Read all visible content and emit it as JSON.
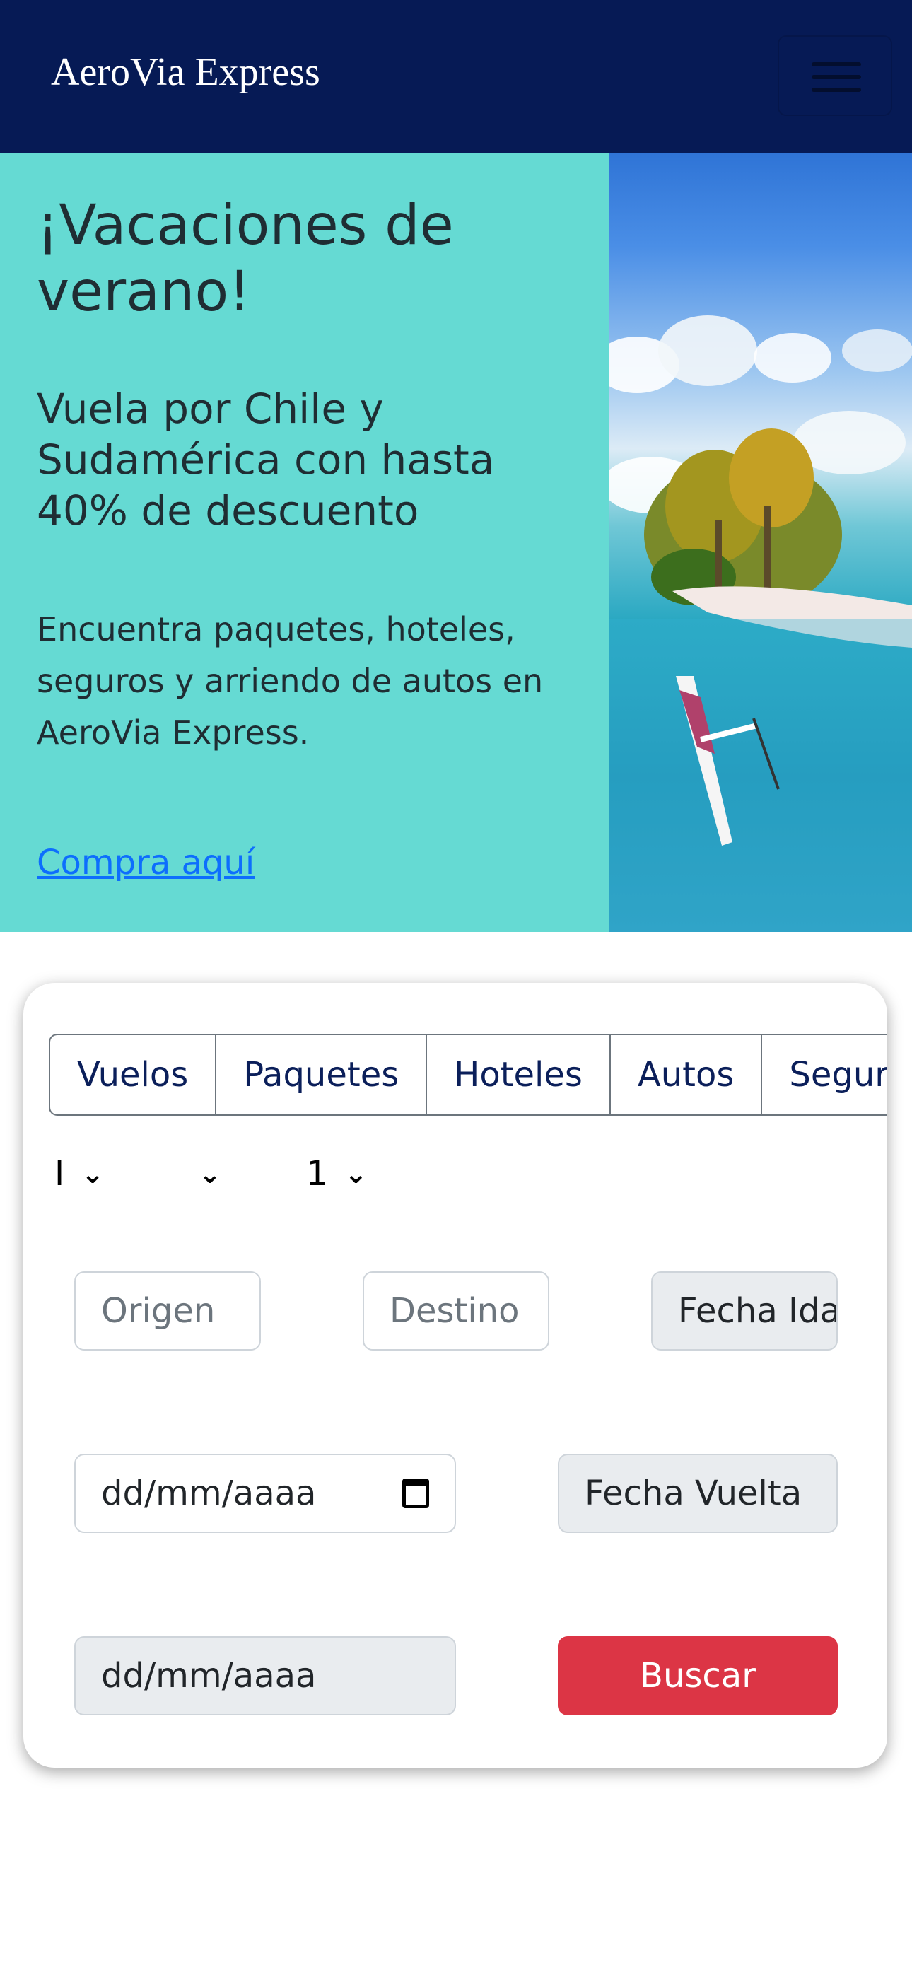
{
  "navbar": {
    "brand": "AeroVia Express"
  },
  "hero": {
    "title": "¡Vacaciones de verano!",
    "subtitle": "Vuela por Chile y Sudamérica con hasta 40% de descuento",
    "text": "Encuentra paquetes, hoteles, seguros y arriendo de autos en AeroVia Express.",
    "link": "Compra aquí"
  },
  "search": {
    "tabs": [
      "Vuelos",
      "Paquetes",
      "Hoteles",
      "Autos",
      "Seguros"
    ],
    "trip_type_value": "I",
    "class_value": "",
    "passengers_value": "1",
    "origin_placeholder": "Origen",
    "destination_placeholder": "Destino",
    "date_out_label": "Fecha Ida",
    "date_out_value": "dd/mm/aaaa",
    "date_return_label": "Fecha Vuelta",
    "date_return_value": "dd/mm/aaaa",
    "search_button": "Buscar"
  },
  "colors": {
    "navbar": "#061a55",
    "hero_bg": "#65dad3",
    "link": "#0d6efd",
    "button": "#dc3545"
  }
}
